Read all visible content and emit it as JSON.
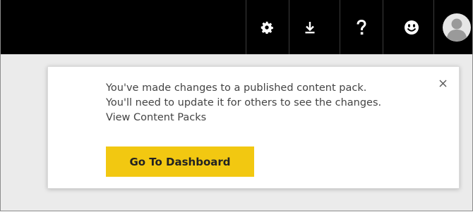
{
  "topbar": {
    "buttons": [
      {
        "icon": "gear-icon",
        "name": "settings"
      },
      {
        "icon": "download-icon",
        "name": "download"
      },
      {
        "icon": "help-icon",
        "name": "help"
      },
      {
        "icon": "smiley-icon",
        "name": "feedback"
      },
      {
        "icon": "avatar-icon",
        "name": "account"
      }
    ],
    "background": "#000000"
  },
  "notification": {
    "line1": "You've made changes to a published content pack.",
    "line2": "You'll need to update it for others to see the changes.",
    "link": "View Content Packs",
    "button_label": "Go To Dashboard",
    "button_color": "#f2c811",
    "close_icon": "close-icon"
  }
}
